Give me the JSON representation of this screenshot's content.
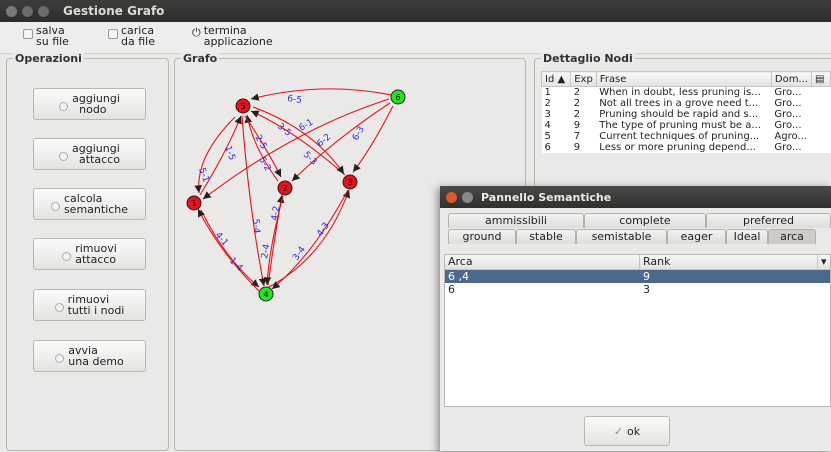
{
  "window": {
    "title": "Gestione Grafo"
  },
  "toolbar": {
    "save": [
      "salva",
      "su file"
    ],
    "load": [
      "carica",
      "da file"
    ],
    "quit": [
      "termina",
      "applicazione"
    ]
  },
  "operazioni": {
    "title": "Operazioni",
    "buttons": [
      [
        "aggiungi",
        "nodo"
      ],
      [
        "aggiungi",
        "attacco"
      ],
      [
        "calcola",
        "semantiche"
      ],
      [
        "rimuovi",
        "attacco"
      ],
      [
        "rimuovi",
        "tutti i nodi"
      ],
      [
        "avvia",
        "una demo"
      ]
    ]
  },
  "grafo": {
    "title": "Grafo",
    "nodes": [
      {
        "id": "5",
        "color": "#e8101a"
      },
      {
        "id": "6",
        "color": "#1ee81a"
      },
      {
        "id": "1",
        "color": "#e8101a"
      },
      {
        "id": "2",
        "color": "#e8101a"
      },
      {
        "id": "3",
        "color": "#e8101a"
      },
      {
        "id": "4",
        "color": "#1ee81a"
      }
    ],
    "edge_labels": [
      "6-5",
      "5-1",
      "1-5",
      "2-5",
      "5-2",
      "3-5",
      "5-3",
      "6-2",
      "6-3",
      "6-1",
      "1-4",
      "4-1",
      "5-4",
      "4-2",
      "2-4",
      "4-3",
      "3-4"
    ],
    "edge_color": "#e8101a",
    "label_color": "#2a2ad8"
  },
  "dettaglio": {
    "title": "Dettaglio Nodi",
    "columns": [
      "Id ▲",
      "Exp",
      "Frase",
      "Dom..."
    ],
    "rows": [
      [
        "1",
        "2",
        "When in doubt, less pruning is...",
        "Gro..."
      ],
      [
        "2",
        "2",
        "Not all trees in a grove need t...",
        "Gro..."
      ],
      [
        "3",
        "2",
        "Pruning should be rapid and s...",
        "Gro..."
      ],
      [
        "4",
        "9",
        "The type of pruning must be a...",
        "Gro..."
      ],
      [
        "5",
        "7",
        "Current techniques of pruning...",
        "Agro..."
      ],
      [
        "6",
        "9",
        "Less or more pruning depend...",
        "Gro..."
      ]
    ]
  },
  "dialog": {
    "title": "Pannello Semantiche",
    "tabs_row1": [
      "ammissibili",
      "complete",
      "preferred"
    ],
    "tabs_row2": [
      "ground",
      "stable",
      "semistable",
      "eager",
      "Ideal",
      "arca"
    ],
    "selected_tab": "arca",
    "columns": [
      "Arca",
      "Rank"
    ],
    "rows": [
      [
        "6 ,4",
        "9"
      ],
      [
        "6",
        "3"
      ]
    ],
    "ok": "ok"
  }
}
